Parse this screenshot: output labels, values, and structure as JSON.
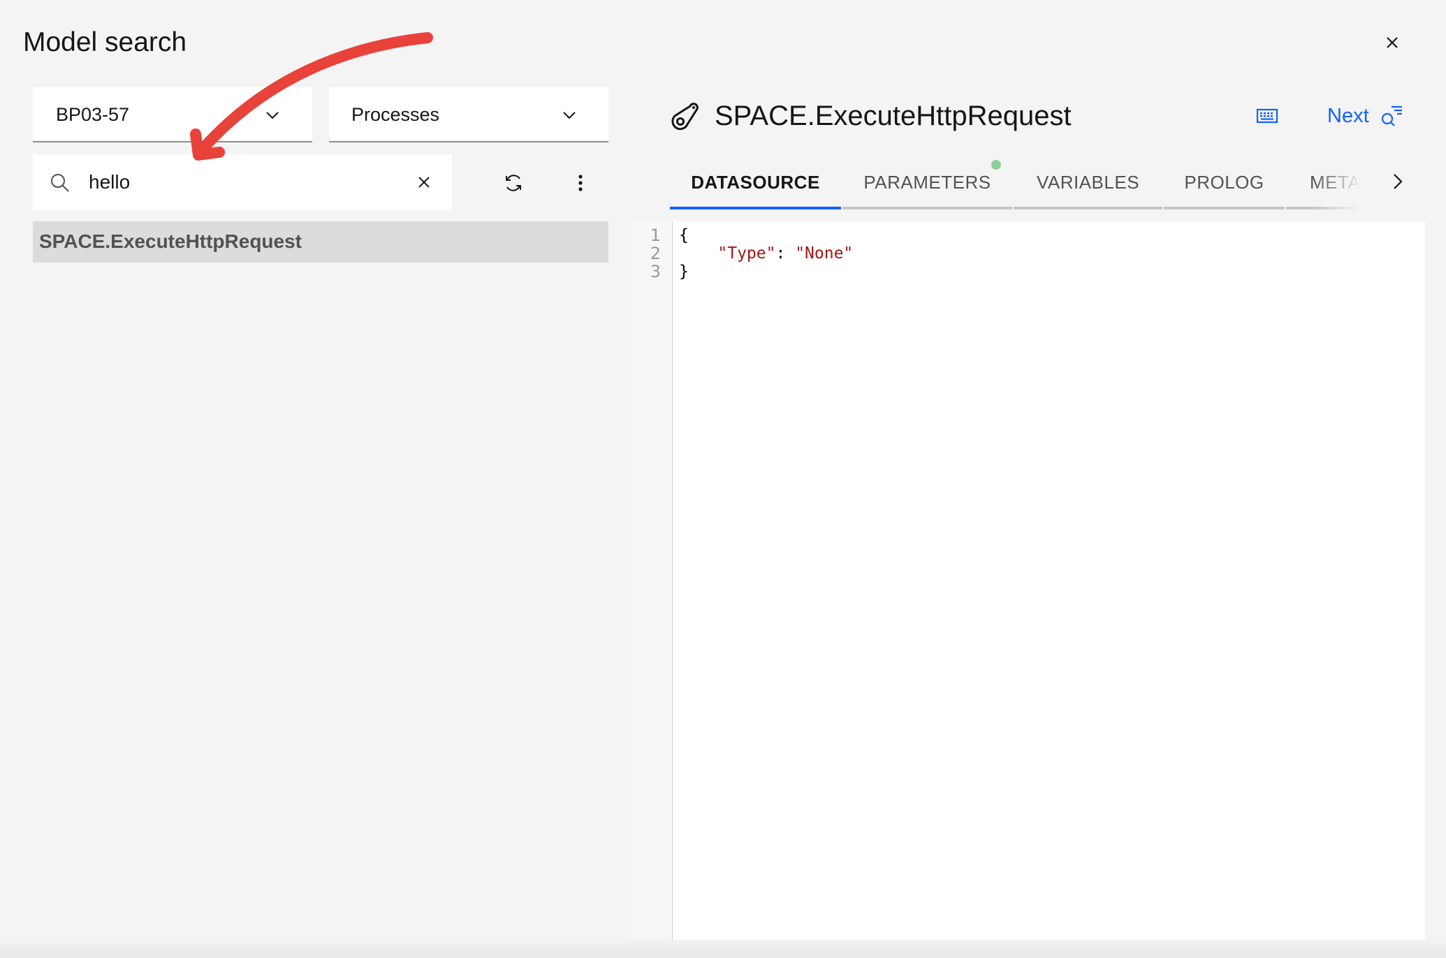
{
  "dialog": {
    "title": "Model search",
    "close_label": "Close"
  },
  "filters": {
    "server": {
      "selected": "BP03-57"
    },
    "object_type": {
      "selected": "Processes"
    }
  },
  "search": {
    "value": "hello",
    "placeholder": "Search"
  },
  "results": [
    {
      "label": "SPACE.ExecuteHttpRequest",
      "selected": true
    }
  ],
  "detail": {
    "title": "SPACE.ExecuteHttpRequest",
    "icon": "process-icon",
    "next_label": "Next",
    "tabs": [
      {
        "label": "DATASOURCE",
        "active": true
      },
      {
        "label": "PARAMETERS",
        "active": false,
        "indicator": "green-dot"
      },
      {
        "label": "VARIABLES",
        "active": false
      },
      {
        "label": "PROLOG",
        "active": false
      },
      {
        "label": "METADATA",
        "active": false,
        "visible_text": "METAD"
      }
    ],
    "editor": {
      "line_numbers": [
        "1",
        "2",
        "3"
      ],
      "lines": [
        {
          "text": "{"
        },
        {
          "indent": "    ",
          "key": "\"Type\"",
          "sep": ": ",
          "value": "\"None\""
        },
        {
          "text": "}"
        }
      ]
    }
  },
  "colors": {
    "accent": "#0f62fe",
    "annotation": "#e8423a",
    "tab_indicator": "#8fcf98",
    "json_string": "#a31515"
  },
  "annotation": {
    "type": "red-arrow",
    "points_to": "search-input"
  }
}
